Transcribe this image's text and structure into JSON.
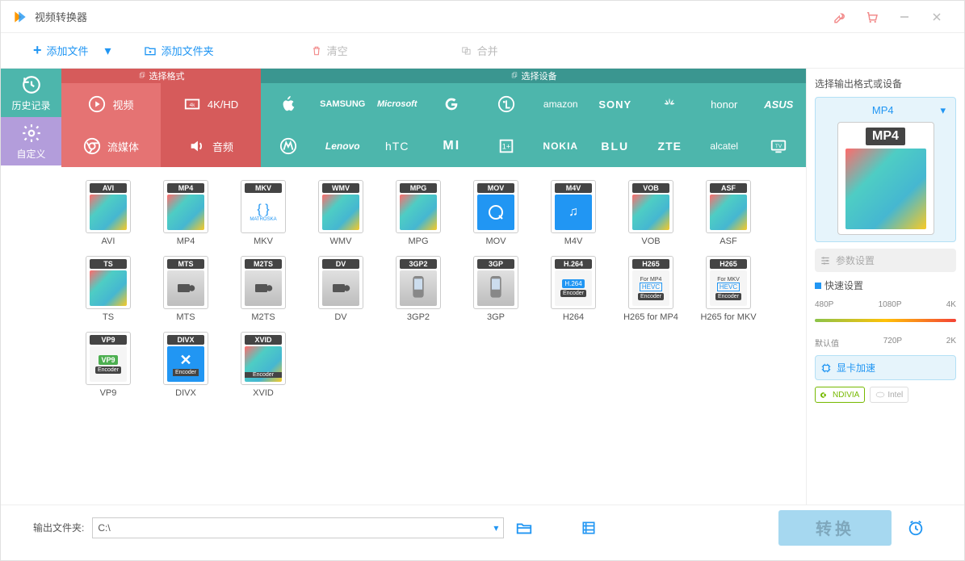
{
  "app": {
    "title": "视频转换器"
  },
  "toolbar": {
    "add_file": "添加文件",
    "add_folder": "添加文件夹",
    "clear": "清空",
    "merge": "合并"
  },
  "sidebar": {
    "history": "历史记录",
    "custom": "自定义"
  },
  "category_header": {
    "format": "选择格式",
    "device": "选择设备"
  },
  "categories": {
    "row1": {
      "video": "视频",
      "hd": "4K/HD",
      "brands": [
        "Apple",
        "SAMSUNG",
        "Microsoft",
        "Google",
        "LG",
        "amazon",
        "SONY",
        "HUAWEI",
        "honor",
        "ASUS"
      ]
    },
    "row2": {
      "stream": "流媒体",
      "audio": "音频",
      "brands": [
        "Motorola",
        "Lenovo",
        "hTC",
        "MI",
        "OnePlus",
        "NOKIA",
        "BLU",
        "ZTE",
        "alcatel",
        "TV"
      ]
    }
  },
  "formats": [
    {
      "badge": "AVI",
      "label": "AVI",
      "thumb": "color"
    },
    {
      "badge": "MP4",
      "label": "MP4",
      "thumb": "color"
    },
    {
      "badge": "MKV",
      "label": "MKV",
      "thumb": "mkv"
    },
    {
      "badge": "WMV",
      "label": "WMV",
      "thumb": "color"
    },
    {
      "badge": "MPG",
      "label": "MPG",
      "thumb": "color"
    },
    {
      "badge": "MOV",
      "label": "MOV",
      "thumb": "qt"
    },
    {
      "badge": "M4V",
      "label": "M4V",
      "thumb": "itunes"
    },
    {
      "badge": "VOB",
      "label": "VOB",
      "thumb": "color"
    },
    {
      "badge": "ASF",
      "label": "ASF",
      "thumb": "color"
    },
    {
      "badge": "TS",
      "label": "TS",
      "thumb": "color"
    },
    {
      "badge": "MTS",
      "label": "MTS",
      "thumb": "cam"
    },
    {
      "badge": "M2TS",
      "label": "M2TS",
      "thumb": "cam"
    },
    {
      "badge": "DV",
      "label": "DV",
      "thumb": "cam"
    },
    {
      "badge": "3GP2",
      "label": "3GP2",
      "thumb": "phone"
    },
    {
      "badge": "3GP",
      "label": "3GP",
      "thumb": "phone"
    },
    {
      "badge": "H.264",
      "label": "H264",
      "thumb": "h264"
    },
    {
      "badge": "H265",
      "label": "H265 for MP4",
      "thumb": "hevc",
      "sub": "For MP4"
    },
    {
      "badge": "H265",
      "label": "H265 for MKV",
      "thumb": "hevc",
      "sub": "For MKV"
    },
    {
      "badge": "VP9",
      "label": "VP9",
      "thumb": "vp9"
    },
    {
      "badge": "DIVX",
      "label": "DIVX",
      "thumb": "divx"
    },
    {
      "badge": "XVID",
      "label": "XVID",
      "thumb": "xvid"
    }
  ],
  "rightpanel": {
    "header": "选择输出格式或设备",
    "selected": "MP4",
    "big_badge": "MP4",
    "param_btn": "参数设置",
    "quick_label": "快速设置",
    "resolutions_top": [
      "480P",
      "1080P",
      "4K"
    ],
    "resolutions_bot": [
      "默认值",
      "720P",
      "2K"
    ],
    "gpu_btn": "显卡加速",
    "gpu_tags": [
      {
        "name": "NDIVIA",
        "type": "nv"
      },
      {
        "name": "Intel",
        "type": "intel"
      }
    ]
  },
  "bottom": {
    "output_label": "输出文件夹:",
    "path": "C:\\",
    "convert": "转换"
  }
}
